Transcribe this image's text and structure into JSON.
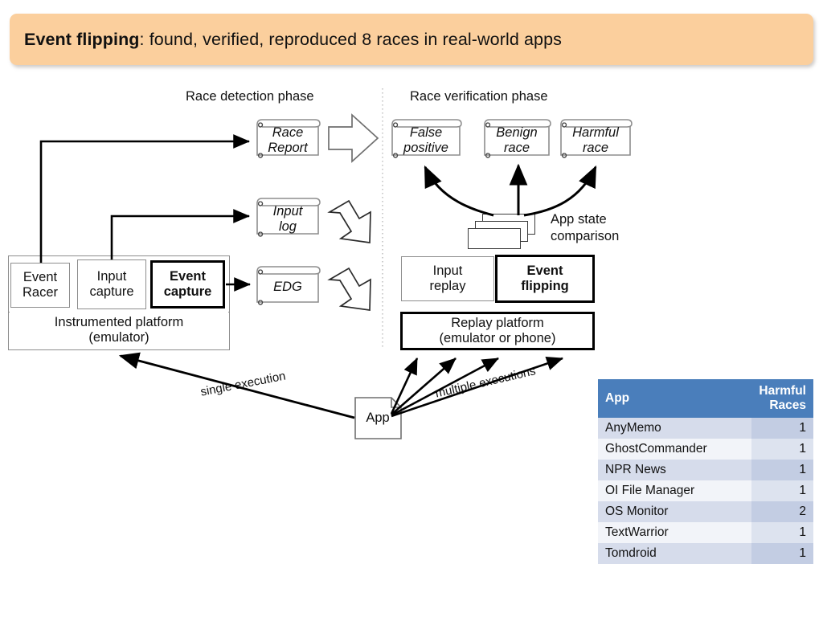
{
  "title": {
    "strong": "Event flipping",
    "rest": ": found, verified, reproduced 8 races in real-world apps"
  },
  "diagram": {
    "phases": {
      "detection": "Race detection phase",
      "verification": "Race verification phase"
    },
    "platform_left": "Instrumented platform\n(emulator)",
    "platform_right": "Replay platform\n(emulator or phone)",
    "components": {
      "event_racer": "Event\nRacer",
      "input_capture": "Input\ncapture",
      "event_capture": "Event\ncapture",
      "input_replay": "Input\nreplay",
      "event_flipping": "Event\nflipping"
    },
    "artifacts": {
      "race_report": "Race\nReport",
      "input_log": "Input\nlog",
      "edg": "EDG",
      "false_positive": "False\npositive",
      "benign_race": "Benign\nrace",
      "harmful_race": "Harmful\nrace"
    },
    "app_node": "App",
    "app_state_comparison": "App state\ncomparison",
    "edge_labels": {
      "single": "single execution",
      "multiple": "multiple executions"
    }
  },
  "table": {
    "columns": [
      "App",
      "Harmful\nRaces"
    ],
    "rows": [
      {
        "app": "AnyMemo",
        "races": "1"
      },
      {
        "app": "GhostCommander",
        "races": "1"
      },
      {
        "app": "NPR News",
        "races": "1"
      },
      {
        "app": "OI File Manager",
        "races": "1"
      },
      {
        "app": "OS Monitor",
        "races": "2"
      },
      {
        "app": "TextWarrior",
        "races": "1"
      },
      {
        "app": "Tomdroid",
        "races": "1"
      }
    ]
  },
  "colors": {
    "banner": "#fbcf9d",
    "table_header": "#4a7ebb",
    "row_band_dark": "#d6dceb",
    "row_band_light": "#f2f4f9"
  }
}
